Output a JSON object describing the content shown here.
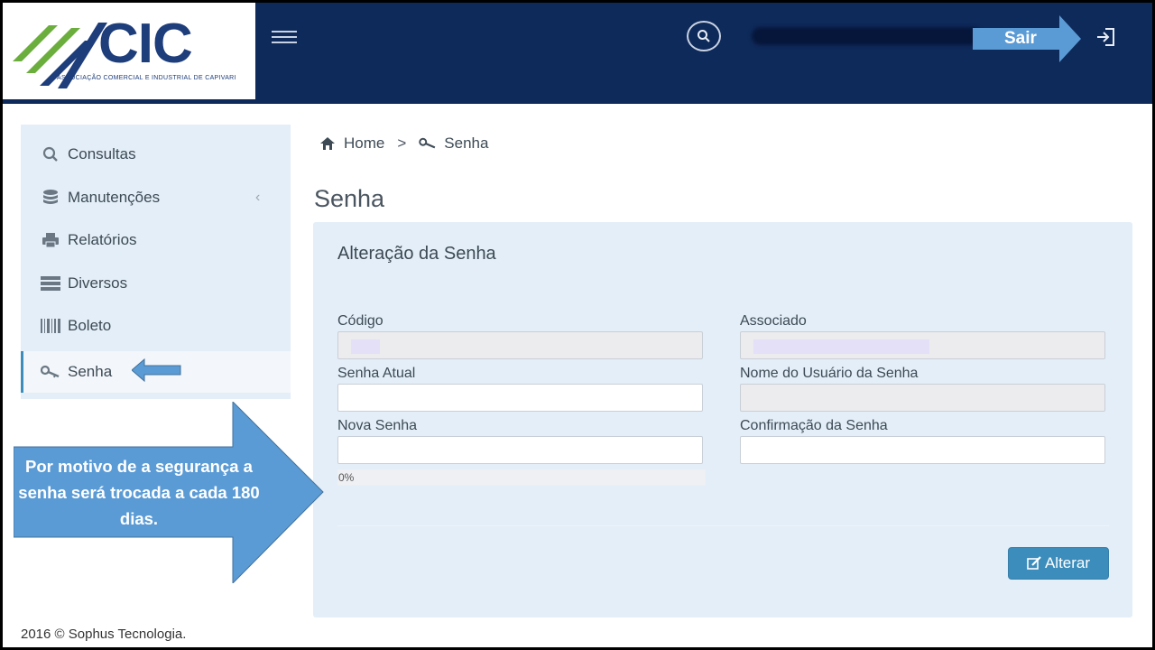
{
  "brand": {
    "logo_text": "CIC",
    "logo_subtitle": "ASSOCIAÇÃO COMERCIAL E INDUSTRIAL DE CAPIVARI"
  },
  "header": {
    "logout_annotation": "Sair"
  },
  "sidebar": {
    "items": [
      {
        "label": "Consultas",
        "icon": "search-icon"
      },
      {
        "label": "Manutenções",
        "icon": "database-icon",
        "chevron": "‹"
      },
      {
        "label": "Relatórios",
        "icon": "printer-icon"
      },
      {
        "label": "Diversos",
        "icon": "server-icon"
      },
      {
        "label": "Boleto",
        "icon": "barcode-icon"
      },
      {
        "label": "Senha",
        "icon": "key-icon",
        "active": true
      }
    ]
  },
  "breadcrumb": {
    "home": "Home",
    "separator": ">",
    "current": "Senha"
  },
  "page": {
    "title": "Senha"
  },
  "form": {
    "panel_title": "Alteração da Senha",
    "codigo_label": "Código",
    "associado_label": "Associado",
    "senha_atual_label": "Senha Atual",
    "nome_usuario_label": "Nome do Usuário da Senha",
    "nova_senha_label": "Nova Senha",
    "confirmacao_label": "Confirmação da Senha",
    "password_strength": "0%",
    "submit_label": "Alterar"
  },
  "annotation": {
    "callout_text": "Por motivo de a segurança a senha será trocada a cada 180 dias."
  },
  "footer": {
    "text": "2016 © Sophus Tecnologia."
  },
  "colors": {
    "header_bg": "#0e2a5a",
    "panel_bg": "#e3eef8",
    "accent": "#3c8dbc",
    "annotation_blue": "#5b9bd5"
  }
}
